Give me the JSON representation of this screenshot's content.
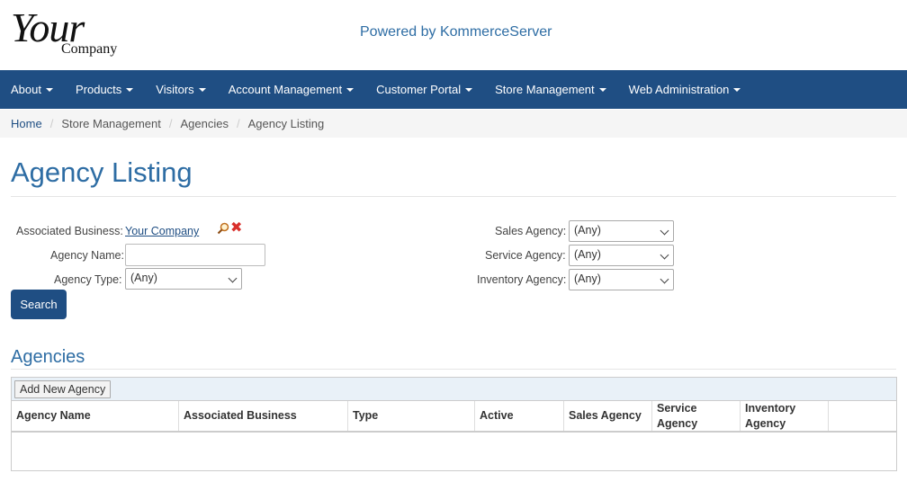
{
  "header": {
    "logo": {
      "word": "Your",
      "company": "Company"
    },
    "powered_by": "Powered by KommerceServer"
  },
  "nav": {
    "items": [
      {
        "label": "About"
      },
      {
        "label": "Products"
      },
      {
        "label": "Visitors"
      },
      {
        "label": "Account Management"
      },
      {
        "label": "Customer Portal"
      },
      {
        "label": "Store Management"
      },
      {
        "label": "Web Administration"
      }
    ]
  },
  "breadcrumb": [
    "Home",
    "Store Management",
    "Agencies",
    "Agency Listing"
  ],
  "page_title": "Agency Listing",
  "filters": {
    "associated_business_label": "Associated Business:",
    "associated_business_value": "Your Company",
    "agency_name_label": "Agency Name:",
    "agency_name_value": "",
    "agency_type_label": "Agency Type:",
    "agency_type_value": "(Any)",
    "sales_agency_label": "Sales Agency:",
    "sales_agency_value": "(Any)",
    "service_agency_label": "Service Agency:",
    "service_agency_value": "(Any)",
    "inventory_agency_label": "Inventory Agency:",
    "inventory_agency_value": "(Any)",
    "search_button": "Search"
  },
  "agencies": {
    "section_title": "Agencies",
    "add_button": "Add New Agency",
    "columns": [
      "Agency Name",
      "Associated Business",
      "Type",
      "Active",
      "Sales Agency",
      "Service Agency",
      "Inventory Agency"
    ],
    "rows": []
  },
  "colors": {
    "nav_bg": "#1f4e83",
    "heading": "#2e6da4",
    "button": "#1f4e83",
    "clear_icon": "#d9302c"
  },
  "icons": {
    "lookup": "magnifier-icon",
    "clear": "red-x-icon",
    "dropdown": "caret-down-icon"
  }
}
